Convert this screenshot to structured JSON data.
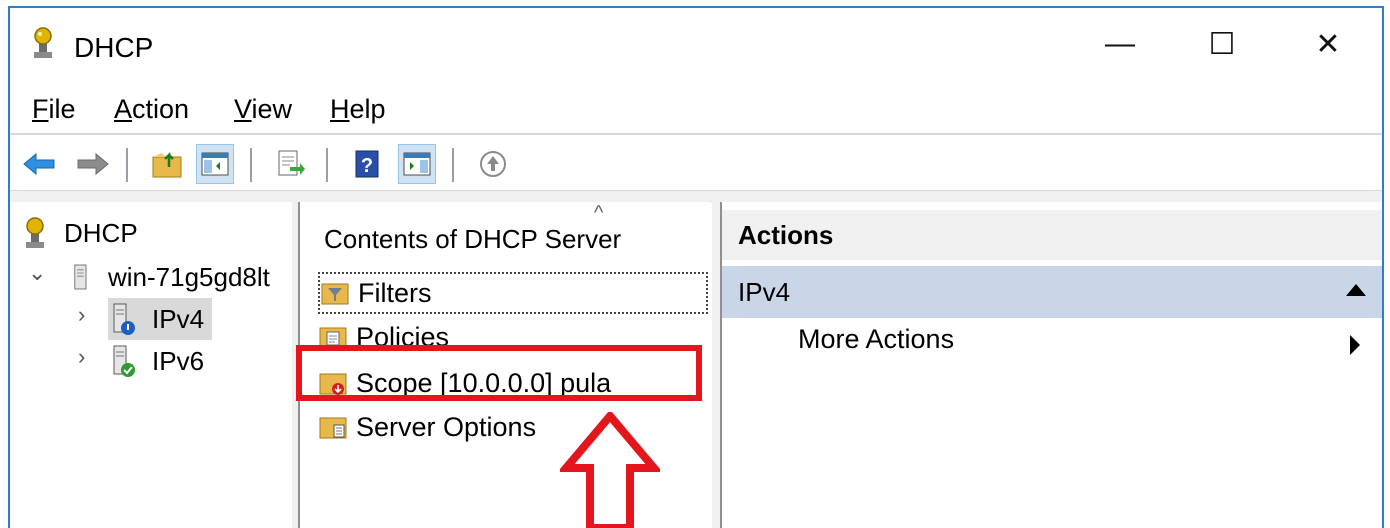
{
  "window": {
    "title": "DHCP",
    "controls": {
      "minimize": "—",
      "maximize": "☐",
      "close": "✕"
    }
  },
  "menu": {
    "file": {
      "hotkey": "F",
      "rest": "ile"
    },
    "action": {
      "hotkey": "A",
      "rest": "ction"
    },
    "view": {
      "hotkey": "V",
      "rest": "iew"
    },
    "help": {
      "hotkey": "H",
      "rest": "elp"
    }
  },
  "toolbar": {
    "buttons": [
      "back-arrow-icon",
      "forward-arrow-icon",
      "up-folder-icon",
      "show-hide-console-tree-icon",
      "export-list-icon",
      "help-icon",
      "show-hide-action-pane-icon",
      "status-up-icon"
    ]
  },
  "tree": {
    "root": "DHCP",
    "server": "win-71g5gd8lt",
    "children": [
      "IPv4",
      "IPv6"
    ],
    "selected": "IPv4"
  },
  "content": {
    "column_header": "Contents of DHCP Server",
    "items": [
      "Filters",
      "Policies",
      "Scope [10.0.0.0] pula",
      "Server Options"
    ]
  },
  "actions": {
    "header": "Actions",
    "group": "IPv4",
    "items": [
      "More Actions"
    ]
  },
  "colors": {
    "window_border": "#2b7cd3",
    "annotation_red": "#e3161e",
    "actions_group_bg": "#c8d6e8",
    "selection_bg": "#d9d9d9"
  }
}
